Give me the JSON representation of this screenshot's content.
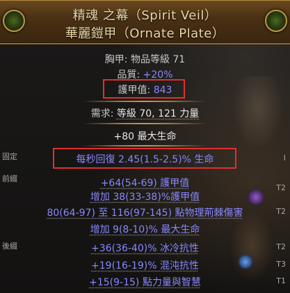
{
  "item": {
    "name_line1": "精魂 之幕（Spirit Veil）",
    "name_line2": "華麗鎧甲（Ornate Plate）"
  },
  "properties": {
    "type_level": "胸甲: 物品等級 71",
    "quality_label": "品質: ",
    "quality_value": "+20%",
    "armour_label": "護甲值: ",
    "armour_value": "843",
    "req_label": "需求: ",
    "req_text": "等級 70, 121 力量"
  },
  "implicit": {
    "line": "+80 最大生命"
  },
  "sections": {
    "fixed": "固定",
    "prefix": "前綴",
    "suffix": "後綴"
  },
  "mods": [
    {
      "text": "每秒回復 2.45(1.5-2.5)% 生命",
      "tier": "I"
    },
    {
      "text": "+64(54-69) 護甲值",
      "tier": "T2"
    },
    {
      "text": "增加 38(33-38)%護甲值",
      "tier": ""
    },
    {
      "text": "80(64-97) 至 116(97-145) 點物理荊棘傷害",
      "tier": "T2"
    },
    {
      "text": "增加 9(8-10)% 最大生命",
      "tier": ""
    },
    {
      "text": "+36(36-40)% 冰冷抗性",
      "tier": "T2"
    },
    {
      "text": "+19(16-19)% 混沌抗性",
      "tier": "T3"
    },
    {
      "text": "+15(9-15) 點力量與智慧",
      "tier": "T1"
    }
  ],
  "colors": {
    "header_text": "#e8d6a8",
    "magic_blue": "#8888ff",
    "highlight_red": "#e03030"
  }
}
